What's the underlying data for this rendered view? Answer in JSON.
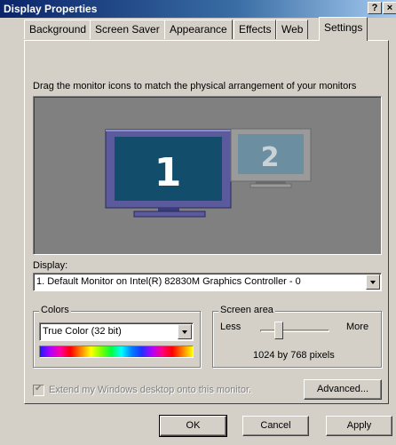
{
  "window": {
    "title": "Display Properties",
    "help_label": "?",
    "close_label": "×"
  },
  "tabs": [
    {
      "label": "Background"
    },
    {
      "label": "Screen Saver"
    },
    {
      "label": "Appearance"
    },
    {
      "label": "Effects"
    },
    {
      "label": "Web"
    },
    {
      "label": "Settings",
      "active": true
    }
  ],
  "settings": {
    "instruction": "Drag the monitor icons to match the physical arrangement of your monitors",
    "monitors": [
      {
        "number": "1",
        "selected": true
      },
      {
        "number": "2",
        "selected": false
      }
    ],
    "display_label": "Display:",
    "display_value": "1. Default Monitor on Intel(R) 82830M Graphics Controller - 0",
    "colors": {
      "group_label": "Colors",
      "value": "True Color (32 bit)"
    },
    "screen_area": {
      "group_label": "Screen area",
      "less_label": "Less",
      "more_label": "More",
      "resolution": "1024 by 768 pixels",
      "slider_level": 0.2
    },
    "extend_desktop": {
      "label": "Extend my Windows desktop onto this monitor.",
      "checked": true,
      "enabled": false
    },
    "advanced_label": "Advanced..."
  },
  "buttons": {
    "ok": "OK",
    "cancel": "Cancel",
    "apply": "Apply"
  },
  "colors": {
    "titlebar": "#0a246a",
    "dialog_bg": "#d4d0c8",
    "preview_bg": "#808080",
    "monitor_frame": "#5a5a9c",
    "monitor_screen": "#124d6b"
  }
}
